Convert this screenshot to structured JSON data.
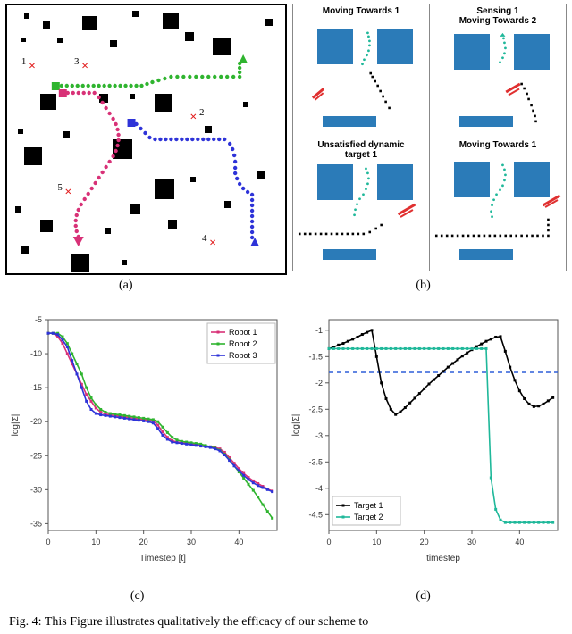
{
  "figure_label": "Fig. 4:",
  "caption_partial": "This Figure illustrates qualitatively the efficacy of our scheme to",
  "sub_labels": {
    "a": "(a)",
    "b": "(b)",
    "c": "(c)",
    "d": "(d)"
  },
  "panel_a": {
    "targets": [
      {
        "id": "1",
        "x_pct": 9,
        "y_pct": 23
      },
      {
        "id": "3",
        "x_pct": 28,
        "y_pct": 23
      },
      {
        "id": "2",
        "x_pct": 67,
        "y_pct": 42
      },
      {
        "id": "5",
        "x_pct": 22,
        "y_pct": 70
      },
      {
        "id": "4",
        "x_pct": 74,
        "y_pct": 89
      }
    ]
  },
  "panel_b": {
    "titles": [
      "Moving Towards  1",
      "Sensing 1\nMoving Towards 2",
      "Unsatisfied dynamic\ntarget 1",
      "Moving Towards  1"
    ]
  },
  "chart_data": [
    {
      "id": "c",
      "type": "line",
      "title": "",
      "xlabel": "Timestep [t]",
      "ylabel": "log|\\u03a3|",
      "xlim": [
        0,
        48
      ],
      "ylim": [
        -36,
        -5
      ],
      "xticks": [
        0,
        10,
        20,
        30,
        40
      ],
      "yticks": [
        -35,
        -30,
        -25,
        -20,
        -15,
        -10,
        -5
      ],
      "legend_position": "upper-right",
      "series": [
        {
          "name": "Robot 1",
          "color": "#d83177",
          "values": [
            [
              0,
              -7
            ],
            [
              1,
              -7
            ],
            [
              2,
              -7.5
            ],
            [
              3,
              -8.5
            ],
            [
              4,
              -10
            ],
            [
              5,
              -11.5
            ],
            [
              6,
              -13
            ],
            [
              7,
              -14.5
            ],
            [
              8,
              -16
            ],
            [
              9,
              -17
            ],
            [
              10,
              -18
            ],
            [
              11,
              -18.6
            ],
            [
              12,
              -18.9
            ],
            [
              13,
              -19.0
            ],
            [
              14,
              -19.1
            ],
            [
              15,
              -19.2
            ],
            [
              16,
              -19.3
            ],
            [
              17,
              -19.4
            ],
            [
              18,
              -19.5
            ],
            [
              19,
              -19.6
            ],
            [
              20,
              -19.7
            ],
            [
              21,
              -19.8
            ],
            [
              22,
              -19.9
            ],
            [
              23,
              -20.5
            ],
            [
              24,
              -21.5
            ],
            [
              25,
              -22.3
            ],
            [
              26,
              -22.8
            ],
            [
              27,
              -23.0
            ],
            [
              28,
              -23.1
            ],
            [
              29,
              -23.2
            ],
            [
              30,
              -23.3
            ],
            [
              31,
              -23.4
            ],
            [
              32,
              -23.5
            ],
            [
              33,
              -23.6
            ],
            [
              34,
              -23.7
            ],
            [
              35,
              -23.8
            ],
            [
              36,
              -24.0
            ],
            [
              37,
              -24.5
            ],
            [
              38,
              -25.3
            ],
            [
              39,
              -26.1
            ],
            [
              40,
              -26.9
            ],
            [
              41,
              -27.6
            ],
            [
              42,
              -28.2
            ],
            [
              43,
              -28.7
            ],
            [
              44,
              -29.1
            ],
            [
              45,
              -29.5
            ],
            [
              46,
              -29.9
            ],
            [
              47,
              -30.2
            ]
          ]
        },
        {
          "name": "Robot 2",
          "color": "#2fb42f",
          "values": [
            [
              0,
              -7
            ],
            [
              1,
              -7
            ],
            [
              2,
              -7
            ],
            [
              3,
              -7.5
            ],
            [
              4,
              -8.5
            ],
            [
              5,
              -10
            ],
            [
              6,
              -11.5
            ],
            [
              7,
              -13
            ],
            [
              8,
              -15
            ],
            [
              9,
              -16.5
            ],
            [
              10,
              -17.5
            ],
            [
              11,
              -18.2
            ],
            [
              12,
              -18.6
            ],
            [
              13,
              -18.8
            ],
            [
              14,
              -18.9
            ],
            [
              15,
              -19.0
            ],
            [
              16,
              -19.1
            ],
            [
              17,
              -19.2
            ],
            [
              18,
              -19.3
            ],
            [
              19,
              -19.4
            ],
            [
              20,
              -19.5
            ],
            [
              21,
              -19.6
            ],
            [
              22,
              -19.7
            ],
            [
              23,
              -20.0
            ],
            [
              24,
              -20.8
            ],
            [
              25,
              -21.6
            ],
            [
              26,
              -22.3
            ],
            [
              27,
              -22.7
            ],
            [
              28,
              -22.9
            ],
            [
              29,
              -23.0
            ],
            [
              30,
              -23.1
            ],
            [
              31,
              -23.2
            ],
            [
              32,
              -23.3
            ],
            [
              33,
              -23.5
            ],
            [
              34,
              -23.7
            ],
            [
              35,
              -23.9
            ],
            [
              36,
              -24.2
            ],
            [
              37,
              -24.8
            ],
            [
              38,
              -25.6
            ],
            [
              39,
              -26.5
            ],
            [
              40,
              -27.4
            ],
            [
              41,
              -28.3
            ],
            [
              42,
              -29.2
            ],
            [
              43,
              -30.1
            ],
            [
              44,
              -31.1
            ],
            [
              45,
              -32.2
            ],
            [
              46,
              -33.2
            ],
            [
              47,
              -34.2
            ]
          ]
        },
        {
          "name": "Robot 3",
          "color": "#2e33d8",
          "values": [
            [
              0,
              -7
            ],
            [
              1,
              -7
            ],
            [
              2,
              -7.2
            ],
            [
              3,
              -8
            ],
            [
              4,
              -9
            ],
            [
              5,
              -11
            ],
            [
              6,
              -13
            ],
            [
              7,
              -15
            ],
            [
              8,
              -17
            ],
            [
              9,
              -18.2
            ],
            [
              10,
              -18.8
            ],
            [
              11,
              -19.0
            ],
            [
              12,
              -19.1
            ],
            [
              13,
              -19.2
            ],
            [
              14,
              -19.3
            ],
            [
              15,
              -19.4
            ],
            [
              16,
              -19.5
            ],
            [
              17,
              -19.6
            ],
            [
              18,
              -19.7
            ],
            [
              19,
              -19.8
            ],
            [
              20,
              -19.9
            ],
            [
              21,
              -20.0
            ],
            [
              22,
              -20.2
            ],
            [
              23,
              -21.0
            ],
            [
              24,
              -22.0
            ],
            [
              25,
              -22.6
            ],
            [
              26,
              -23.0
            ],
            [
              27,
              -23.1
            ],
            [
              28,
              -23.2
            ],
            [
              29,
              -23.3
            ],
            [
              30,
              -23.4
            ],
            [
              31,
              -23.5
            ],
            [
              32,
              -23.6
            ],
            [
              33,
              -23.7
            ],
            [
              34,
              -23.8
            ],
            [
              35,
              -24.0
            ],
            [
              36,
              -24.3
            ],
            [
              37,
              -24.9
            ],
            [
              38,
              -25.7
            ],
            [
              39,
              -26.5
            ],
            [
              40,
              -27.2
            ],
            [
              41,
              -27.9
            ],
            [
              42,
              -28.5
            ],
            [
              43,
              -29.0
            ],
            [
              44,
              -29.4
            ],
            [
              45,
              -29.7
            ],
            [
              46,
              -30.0
            ],
            [
              47,
              -30.3
            ]
          ]
        }
      ]
    },
    {
      "id": "d",
      "type": "line",
      "title": "",
      "xlabel": "timestep",
      "ylabel": "log|\\u03a3|",
      "xlim": [
        0,
        48
      ],
      "ylim": [
        -4.8,
        -0.8
      ],
      "xticks": [
        0,
        10,
        20,
        30,
        40
      ],
      "yticks": [
        -4.5,
        -4.0,
        -3.5,
        -3.0,
        -2.5,
        -2.0,
        -1.5,
        -1.0
      ],
      "legend_position": "lower-left",
      "hline": {
        "y": -1.8,
        "style": "dashed",
        "color": "#2e5fd8"
      },
      "series": [
        {
          "name": "Target 1",
          "color": "#000000",
          "values": [
            [
              0,
              -1.35
            ],
            [
              1,
              -1.32
            ],
            [
              2,
              -1.28
            ],
            [
              3,
              -1.25
            ],
            [
              4,
              -1.21
            ],
            [
              5,
              -1.17
            ],
            [
              6,
              -1.13
            ],
            [
              7,
              -1.08
            ],
            [
              8,
              -1.04
            ],
            [
              9,
              -1.0
            ],
            [
              10,
              -1.5
            ],
            [
              11,
              -2.0
            ],
            [
              12,
              -2.3
            ],
            [
              13,
              -2.5
            ],
            [
              14,
              -2.6
            ],
            [
              15,
              -2.55
            ],
            [
              16,
              -2.47
            ],
            [
              17,
              -2.38
            ],
            [
              18,
              -2.29
            ],
            [
              19,
              -2.2
            ],
            [
              20,
              -2.11
            ],
            [
              21,
              -2.02
            ],
            [
              22,
              -1.94
            ],
            [
              23,
              -1.86
            ],
            [
              24,
              -1.78
            ],
            [
              25,
              -1.7
            ],
            [
              26,
              -1.63
            ],
            [
              27,
              -1.56
            ],
            [
              28,
              -1.49
            ],
            [
              29,
              -1.43
            ],
            [
              30,
              -1.37
            ],
            [
              31,
              -1.31
            ],
            [
              32,
              -1.26
            ],
            [
              33,
              -1.21
            ],
            [
              34,
              -1.17
            ],
            [
              35,
              -1.13
            ],
            [
              36,
              -1.12
            ],
            [
              37,
              -1.4
            ],
            [
              38,
              -1.7
            ],
            [
              39,
              -1.95
            ],
            [
              40,
              -2.15
            ],
            [
              41,
              -2.3
            ],
            [
              42,
              -2.4
            ],
            [
              43,
              -2.45
            ],
            [
              44,
              -2.44
            ],
            [
              45,
              -2.4
            ],
            [
              46,
              -2.34
            ],
            [
              47,
              -2.28
            ]
          ]
        },
        {
          "name": "Target 2",
          "color": "#1fb89a",
          "values": [
            [
              0,
              -1.35
            ],
            [
              1,
              -1.35
            ],
            [
              2,
              -1.35
            ],
            [
              3,
              -1.35
            ],
            [
              4,
              -1.35
            ],
            [
              5,
              -1.35
            ],
            [
              6,
              -1.35
            ],
            [
              7,
              -1.35
            ],
            [
              8,
              -1.35
            ],
            [
              9,
              -1.35
            ],
            [
              10,
              -1.35
            ],
            [
              11,
              -1.35
            ],
            [
              12,
              -1.35
            ],
            [
              13,
              -1.35
            ],
            [
              14,
              -1.35
            ],
            [
              15,
              -1.35
            ],
            [
              16,
              -1.35
            ],
            [
              17,
              -1.35
            ],
            [
              18,
              -1.35
            ],
            [
              19,
              -1.35
            ],
            [
              20,
              -1.35
            ],
            [
              21,
              -1.35
            ],
            [
              22,
              -1.35
            ],
            [
              23,
              -1.35
            ],
            [
              24,
              -1.35
            ],
            [
              25,
              -1.35
            ],
            [
              26,
              -1.35
            ],
            [
              27,
              -1.35
            ],
            [
              28,
              -1.35
            ],
            [
              29,
              -1.35
            ],
            [
              30,
              -1.35
            ],
            [
              31,
              -1.35
            ],
            [
              32,
              -1.35
            ],
            [
              33,
              -1.35
            ],
            [
              34,
              -3.8
            ],
            [
              35,
              -4.4
            ],
            [
              36,
              -4.6
            ],
            [
              37,
              -4.65
            ],
            [
              38,
              -4.65
            ],
            [
              39,
              -4.65
            ],
            [
              40,
              -4.65
            ],
            [
              41,
              -4.65
            ],
            [
              42,
              -4.65
            ],
            [
              43,
              -4.65
            ],
            [
              44,
              -4.65
            ],
            [
              45,
              -4.65
            ],
            [
              46,
              -4.65
            ],
            [
              47,
              -4.65
            ]
          ]
        }
      ]
    }
  ]
}
